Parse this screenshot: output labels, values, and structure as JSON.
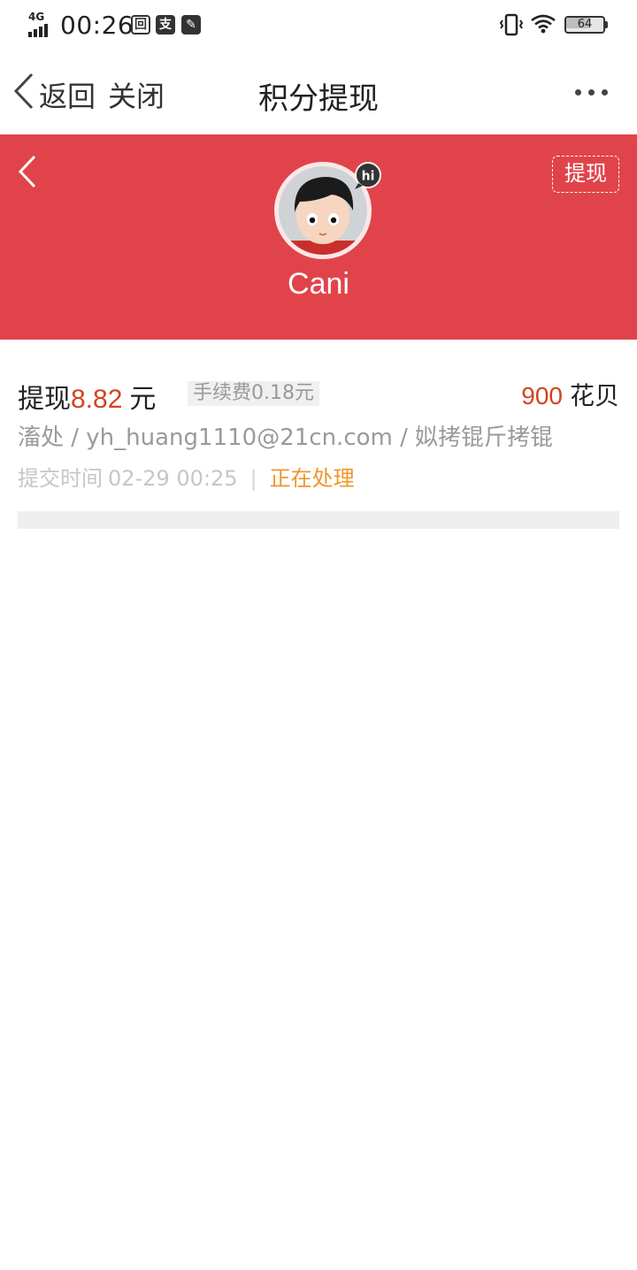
{
  "status_bar": {
    "network": "4G",
    "time": "00:26",
    "battery": "64",
    "battery_level": 0.64,
    "notification_icons": [
      "app-notification-icon",
      "alipay-icon",
      "edit-app-icon"
    ]
  },
  "nav": {
    "back_label": "返回",
    "close_label": "关闭",
    "title": "积分提现",
    "more_icon": "more-dots-icon"
  },
  "hero": {
    "background_color": "#e0444a",
    "withdraw_button": "提现",
    "avatar_badge": "hi",
    "user_name": "Cani"
  },
  "record": {
    "prefix": "提现",
    "amount": "8.82",
    "unit": "元",
    "fee": "手续费0.18元",
    "points": "900",
    "points_unit": "花贝",
    "account": "滀处 / yh_huang1110@21cn.com / 姒拷锟斤拷锟",
    "time_label": "提交时间",
    "time": "02-29 00:25",
    "separator": "|",
    "status": "正在处理",
    "amount_color": "#d2431f",
    "status_color": "#f0952a"
  }
}
